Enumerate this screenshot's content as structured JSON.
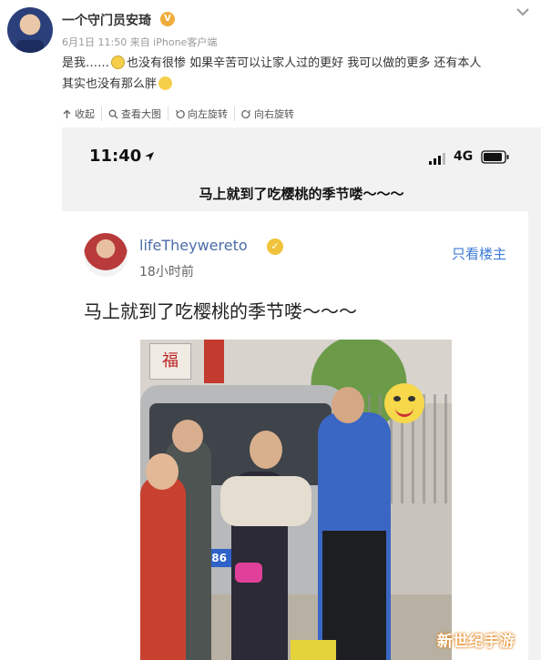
{
  "post": {
    "username": "一个守门员安琦",
    "vip_badge": "V",
    "meta": "6月1日 11:50 来自 iPhone客户端",
    "text_1": "是我……",
    "text_2": "也没有很惨 如果辛苦可以让家人过的更好 我可以做的更多 还有本人",
    "text_3": "其实也没有那么胖",
    "actions": {
      "collapse": "收起",
      "view_large": "查看大图",
      "rotate_left": "向左旋转",
      "rotate_right": "向右旋转"
    }
  },
  "screenshot": {
    "status_time": "11:40",
    "network": "4G",
    "nav_title": "马上就到了吃樱桃的季节喽～～～",
    "inner_post": {
      "username": "lifeTheywereto",
      "time": "18小时前",
      "only_op": "只看楼主",
      "text": "马上就到了吃樱桃的季节喽～～～"
    },
    "photo": {
      "fu_char": "福",
      "plate": "JY86"
    }
  },
  "watermark": "新世纪手游",
  "colors": {
    "link_blue": "#3d7ad6",
    "username_blue": "#4b6ca8",
    "watermark_glow": "#e2851b"
  }
}
